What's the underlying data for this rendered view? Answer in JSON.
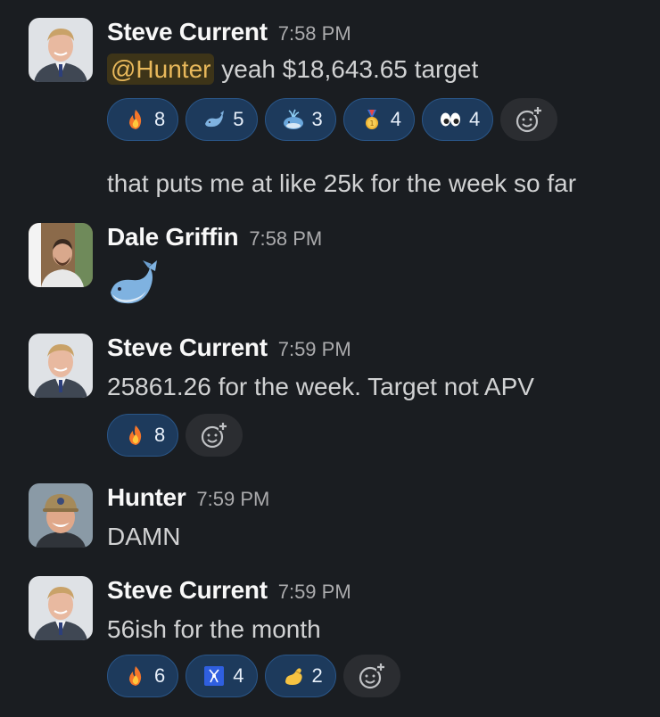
{
  "messages": [
    {
      "author": "Steve Current",
      "time": "7:58 PM",
      "mention": "@Hunter",
      "text": " yeah $18,643.65 target",
      "reactions": [
        {
          "emoji": "fire",
          "count": "8"
        },
        {
          "emoji": "whale",
          "count": "5"
        },
        {
          "emoji": "spouting-whale",
          "count": "3"
        },
        {
          "emoji": "gold-medal",
          "count": "4"
        },
        {
          "emoji": "eyes",
          "count": "4"
        }
      ],
      "followup": "that puts me at like 25k for the week so far"
    },
    {
      "author": "Dale Griffin",
      "time": "7:58 PM",
      "emoji_only": "whale"
    },
    {
      "author": "Steve Current",
      "time": "7:59 PM",
      "text": "25861.26 for the week. Target not APV",
      "reactions": [
        {
          "emoji": "fire",
          "count": "8"
        }
      ]
    },
    {
      "author": "Hunter",
      "time": "7:59 PM",
      "text": "DAMN"
    },
    {
      "author": "Steve Current",
      "time": "7:59 PM",
      "text": "56ish for the month",
      "reactions": [
        {
          "emoji": "fire",
          "count": "6"
        },
        {
          "emoji": "blue-badge",
          "count": "4"
        },
        {
          "emoji": "pinching-hand",
          "count": "2"
        }
      ]
    }
  ],
  "colors": {
    "background": "#1a1d21",
    "reaction_bg": "#1d3a5c",
    "reaction_border": "#2a5688",
    "mention_text": "#e8b85b",
    "mention_bg": "#3d3418"
  }
}
